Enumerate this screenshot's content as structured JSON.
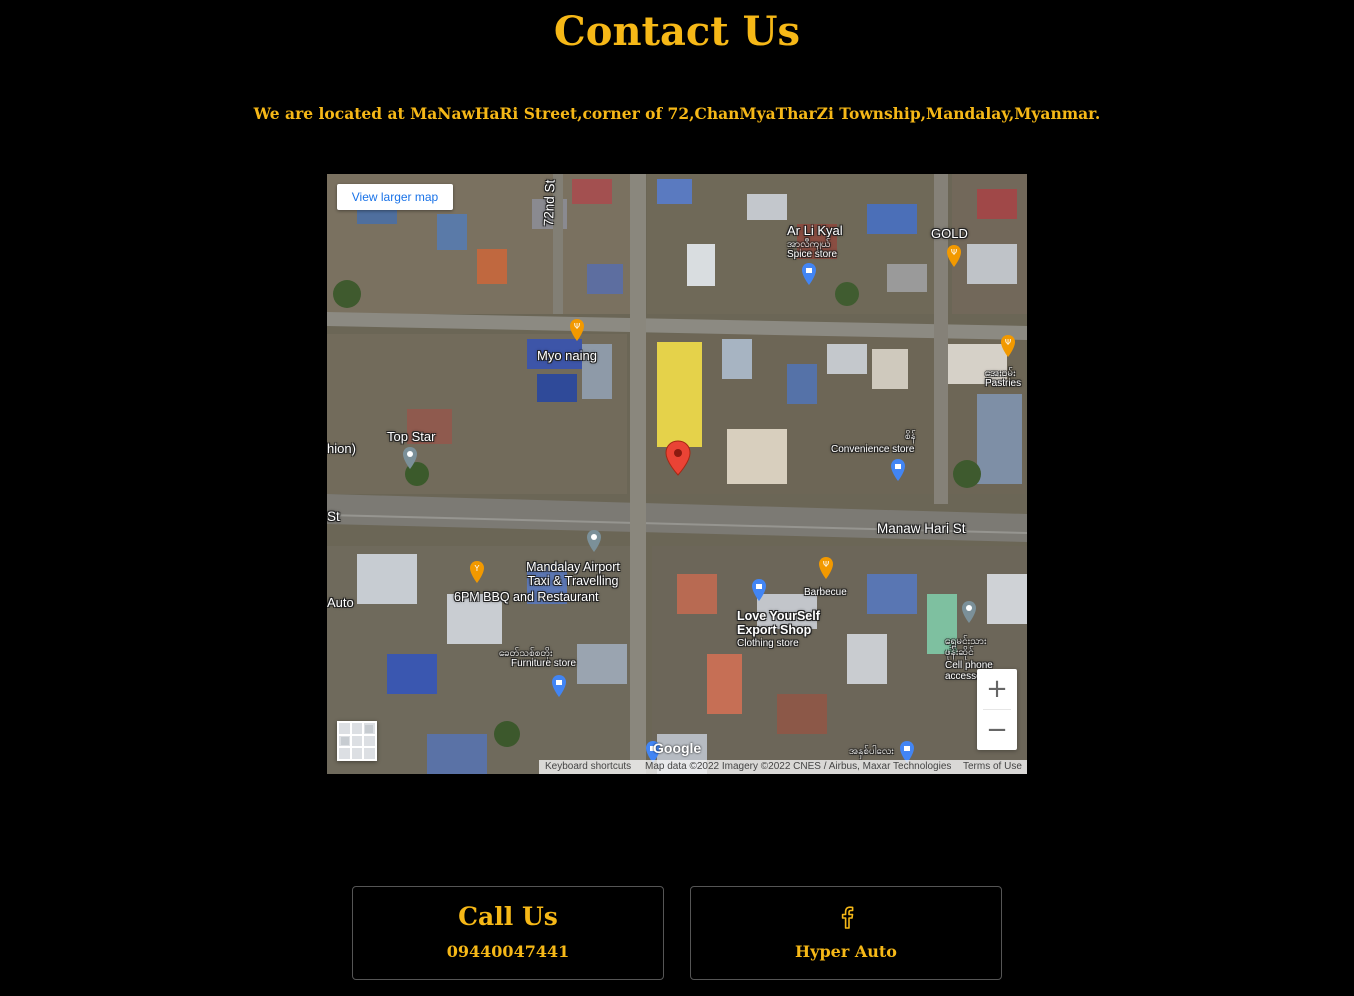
{
  "page": {
    "title": "Contact Us",
    "address": "We are located at MaNawHaRi Street,corner of 72,ChanMyaTharZi Township,Mandalay,Myanmar."
  },
  "map": {
    "view_larger_label": "View larger map",
    "keyboard_shortcuts": "Keyboard shortcuts",
    "map_data": "Map data ©2022 Imagery ©2022 CNES / Airbus, Maxar Technologies",
    "terms": "Terms of Use",
    "zoom_in": "+",
    "zoom_out": "−",
    "logo": "Google",
    "labels": {
      "street_72nd": "72nd St",
      "ar_li_kyal": "Ar Li Kyal",
      "ar_li_kyal_mm": "အာလီကျယ်",
      "spice_store": "Spice store",
      "gold": "GOLD",
      "myo_naing": "Myo naing",
      "pastries_mm": "အေးဝမ်း",
      "pastries": "Pastries",
      "top_star": "Top Star",
      "fashion_fragment": "hion)",
      "conv_mm": "စိန်",
      "convenience_store": "Convenience store",
      "st_fragment": "St",
      "manaw_hari_st": "Manaw Hari St",
      "airport_taxi": "Mandalay Airport\nTaxi & Travelling",
      "bbq": "6PM BBQ and Restaurant",
      "barbecue": "Barbecue",
      "auto_fragment": "Auto",
      "love_yourself": "Love YourSelf\nExport Shop",
      "clothing_store": "Clothing store",
      "furniture_mm": "ခေတ်သစ်စတိုး",
      "furniture_store": "Furniture store",
      "cell_mm": "ရွှေမင်းသား\nဖုန်းဆိုင်",
      "cell_phone": "Cell phone\naccessory store",
      "bottom_mm": "အနှစ်ပါလေး"
    }
  },
  "cards": {
    "call_heading": "Call Us",
    "call_number": "09440047441",
    "fb_icon": "facebook-icon",
    "fb_name": "Hyper Auto"
  },
  "colors": {
    "accent": "#f6b817",
    "background": "#000000"
  }
}
